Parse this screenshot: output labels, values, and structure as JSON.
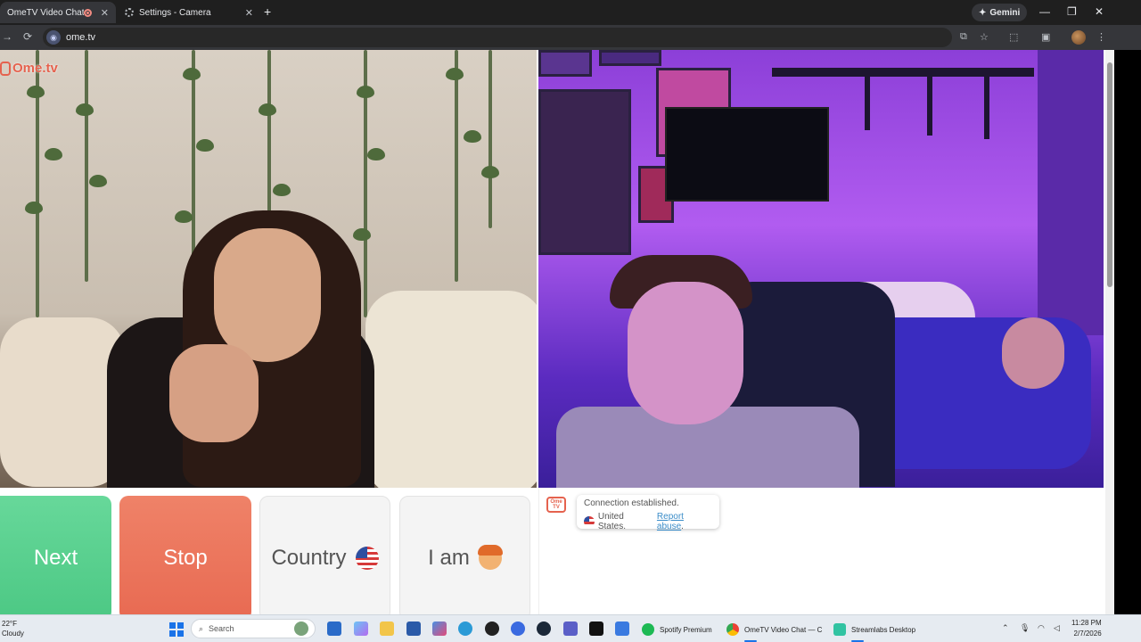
{
  "browser": {
    "tabs": [
      {
        "title": "OmeTV Video Chat — Ome",
        "active": true
      },
      {
        "title": "Settings - Camera",
        "active": false
      }
    ],
    "gemini_label": "Gemini",
    "url": "ome.tv"
  },
  "page": {
    "logo_text": "Ome.tv",
    "buttons": {
      "next": "Next",
      "stop": "Stop",
      "country": "Country",
      "iam": "I am"
    },
    "chat": {
      "avatar_text": "Ome TV",
      "status": "Connection established.",
      "country": "United States.",
      "report": "Report abuse",
      "report_suffix": "."
    }
  },
  "taskbar": {
    "weather_temp": "22°F",
    "weather_desc": "Cloudy",
    "search_placeholder": "Search",
    "apps": [
      {
        "label": "Spotify Premium"
      },
      {
        "label": "OmeTV Video Chat — C"
      },
      {
        "label": "Streamlabs Desktop"
      }
    ],
    "time": "11:28 PM",
    "date": "2/7/2026"
  },
  "colors": {
    "next": "#4cc884",
    "stop": "#e86a52",
    "brand": "#e5624e"
  }
}
